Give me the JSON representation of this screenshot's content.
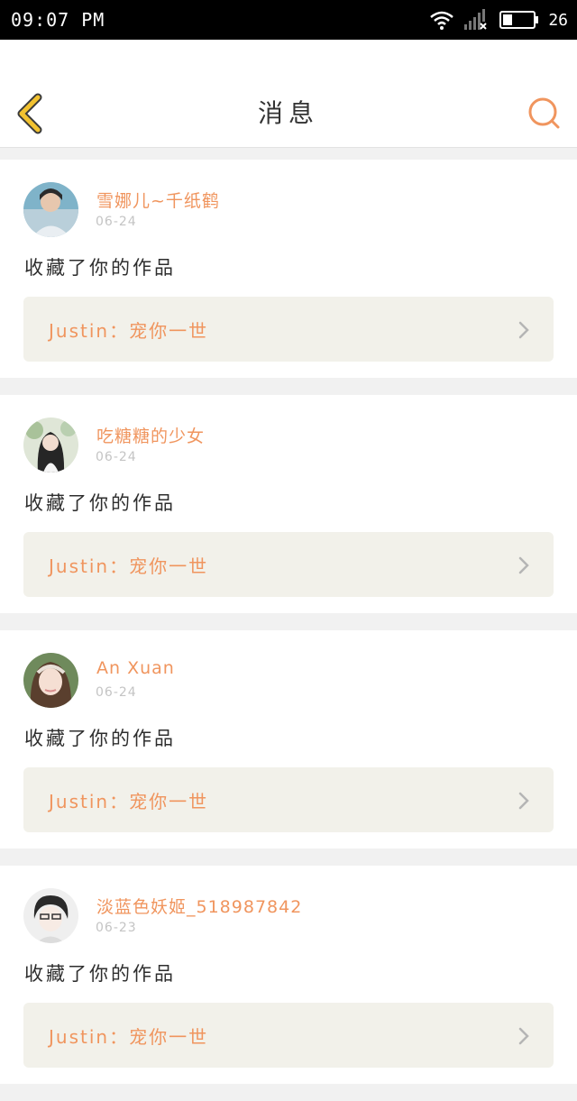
{
  "status_bar": {
    "time": "09:07 PM",
    "battery": "26",
    "icons": [
      "wifi-icon",
      "signal-icon",
      "battery-icon"
    ]
  },
  "header": {
    "title": "消息",
    "back_icon": "chevron-left-icon",
    "search_icon": "search-icon",
    "accent_color": "#f0955e",
    "back_color": "#f2c230"
  },
  "messages": [
    {
      "username": "雪娜儿~千纸鹤",
      "date": "06-24",
      "action": "收藏了你的作品",
      "quote": "Justin：宠你一世"
    },
    {
      "username": "吃糖糖的少女",
      "date": "06-24",
      "action": "收藏了你的作品",
      "quote": "Justin：宠你一世"
    },
    {
      "username": "An Xuan",
      "date": "06-24",
      "action": "收藏了你的作品",
      "quote": "Justin：宠你一世"
    },
    {
      "username": "淡蓝色妖姬_518987842",
      "date": "06-23",
      "action": "收藏了你的作品",
      "quote": "Justin：宠你一世"
    }
  ]
}
